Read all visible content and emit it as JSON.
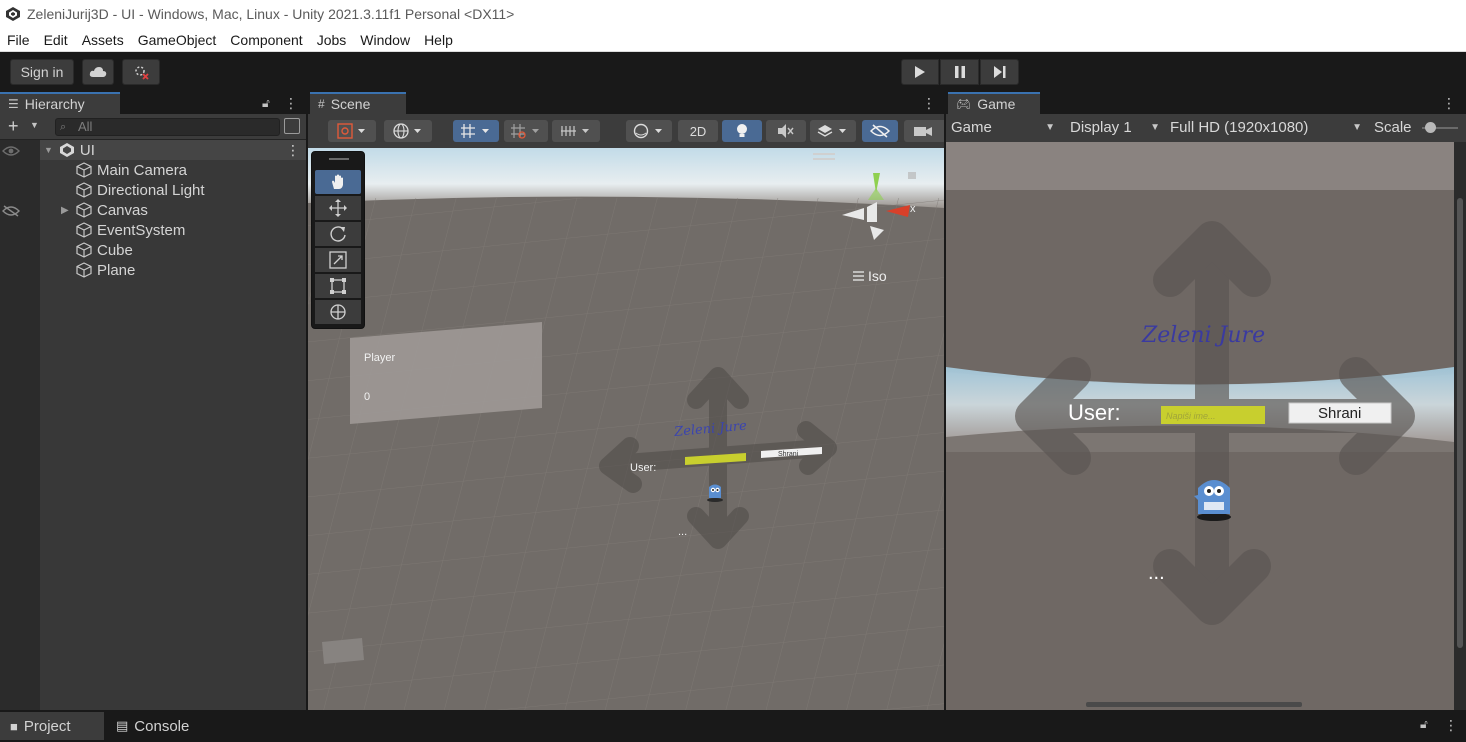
{
  "window": {
    "title": "ZeleniJurij3D - UI - Windows, Mac, Linux - Unity 2021.3.11f1 Personal <DX11>"
  },
  "menu": [
    "File",
    "Edit",
    "Assets",
    "GameObject",
    "Component",
    "Jobs",
    "Window",
    "Help"
  ],
  "toolbar": {
    "sign_in_label": "Sign in"
  },
  "hierarchy": {
    "tab_label": "Hierarchy",
    "search_placeholder": "All",
    "scene_name": "UI",
    "items": [
      {
        "label": "Main Camera",
        "expandable": false
      },
      {
        "label": "Directional Light",
        "expandable": false
      },
      {
        "label": "Canvas",
        "expandable": true
      },
      {
        "label": "EventSystem",
        "expandable": false
      },
      {
        "label": "Cube",
        "expandable": false
      },
      {
        "label": "Plane",
        "expandable": false
      }
    ]
  },
  "scene": {
    "tab_label": "Scene",
    "mode_2d_label": "2D",
    "projection_label": "Iso",
    "gizmo_axis_label": "x",
    "panel_player_label": "Player",
    "panel_player_value": "0",
    "ui_user_label": "User:",
    "ui_button_label": "Shrani",
    "ui_title": "Zeleni Jure",
    "ellipsis": "..."
  },
  "game": {
    "tab_label": "Game",
    "view_dropdown": "Game",
    "display_dropdown": "Display 1",
    "resolution_dropdown": "Full HD (1920x1080)",
    "scale_label": "Scale",
    "scale_value": 0.1,
    "ui_title": "Zeleni Jure",
    "ui_user_label": "User:",
    "ui_input_placeholder": "Napiši ime...",
    "ui_button_label": "Shrani",
    "ellipsis": "..."
  },
  "bottom": {
    "project_label": "Project",
    "console_label": "Console"
  },
  "colors": {
    "accent_blue": "#3a72b0",
    "input_yellow": "#c8cf2e",
    "panel_bg": "#282828"
  }
}
